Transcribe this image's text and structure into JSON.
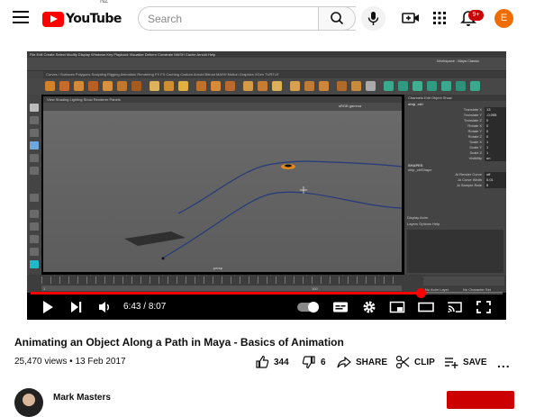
{
  "header": {
    "logo_text": "YouTube",
    "country_code": "NZ",
    "search_placeholder": "Search",
    "notification_count": "9+",
    "avatar_letter": "E"
  },
  "player": {
    "maya": {
      "menu": "File  Edit  Create  Select  Modify  Display  Windows  Key  Playback  Visualize  Deform  Constrain  MASH  Cache  Arnold  Help",
      "workspace": "Workspace : Maya Classic",
      "shelf_tabs": "Curves / Surfaces   Polygons   Sculpting   Rigging   Animation   Rendering   FX   FX Caching   Custom   Arnold   Bifrost   MASH   Motion Graphics   XGen   TURTLE",
      "viewport_menu": "View   Shading   Lighting   Show   Renderer   Panels",
      "gamma": "sRGB gamma",
      "camera_label": "persp",
      "channel_header": "Channels   Edit   Object   Show",
      "object_name": "ship_ctrl",
      "channels": [
        {
          "label": "Translate X",
          "value": "13"
        },
        {
          "label": "Translate Y",
          "value": "-0.095"
        },
        {
          "label": "Translate Z",
          "value": "0"
        },
        {
          "label": "Rotate X",
          "value": "0"
        },
        {
          "label": "Rotate Y",
          "value": "0"
        },
        {
          "label": "Rotate Z",
          "value": "0"
        },
        {
          "label": "Scale X",
          "value": "1"
        },
        {
          "label": "Scale Y",
          "value": "1"
        },
        {
          "label": "Scale Z",
          "value": "1"
        },
        {
          "label": "Visibility",
          "value": "on"
        }
      ],
      "shapes_label": "SHAPES",
      "shape_name": "ship_ctrlShape",
      "shape_channels": [
        {
          "label": "Ai Render Curve",
          "value": "off"
        },
        {
          "label": "Ai Curve Width",
          "value": "0.01"
        },
        {
          "label": "Ai Sample Rate",
          "value": "5"
        }
      ],
      "layer_tabs": "Display   Anim",
      "layer_menu": "Layers   Options   Help",
      "timeline_start": "1",
      "timeline_end": "100",
      "anim_layer": "No Anim Layer",
      "char_set": "No Character Set"
    },
    "current_time": "6:43",
    "duration": "8:07",
    "progress": 0.826
  },
  "video": {
    "title": "Animating an Object Along a Path in Maya - Basics of Animation",
    "views": "25,470 views",
    "date": "13 Feb 2017",
    "meta_sep": " • ",
    "likes": "344",
    "dislikes": "6",
    "share_label": "SHARE",
    "clip_label": "CLIP",
    "save_label": "SAVE",
    "more_label": "..."
  },
  "channel": {
    "name": "Mark Masters"
  },
  "colors": {
    "brand": "#ff0000",
    "subscribe": "#cc0000",
    "avatar": "#ef6c00"
  }
}
